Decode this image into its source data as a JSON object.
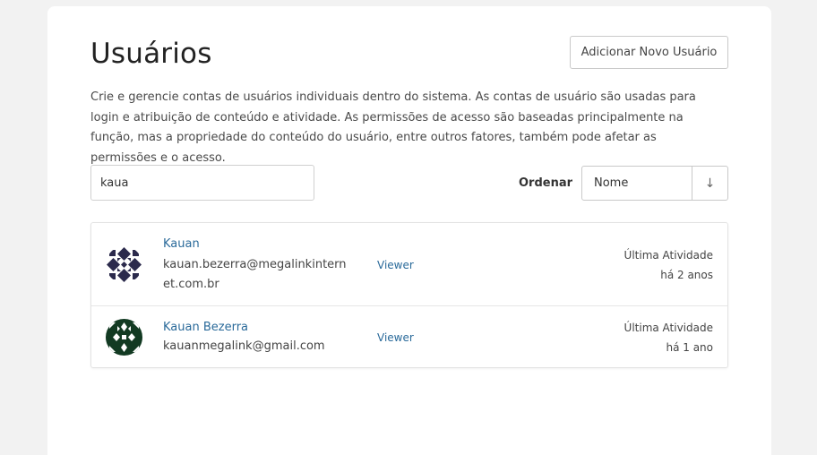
{
  "page": {
    "title": "Usuários",
    "add_button_label": "Adicionar Novo Usuário",
    "description": "Crie e gerencie contas de usuários individuais dentro do sistema. As contas de usuário são usadas para login e atribuição de conteúdo e atividade. As permissões de acesso são baseadas principalmente na função, mas a propriedade do conteúdo do usuário, entre outros fatores, também pode afetar as permissões e o acesso."
  },
  "search": {
    "value": "kaua"
  },
  "sort": {
    "label": "Ordenar",
    "selected": "Nome",
    "direction_icon": "↓"
  },
  "users": [
    {
      "name": "Kauan",
      "email": "kauan.bezerra@megalinkinternet.com.br",
      "role": "Viewer",
      "activity_label": "Última Atividade",
      "activity_value": "há 2 anos",
      "avatar_icon": "identicon-avatar",
      "avatar_color": "#2b2a4c"
    },
    {
      "name": "Kauan Bezerra",
      "email": "kauanmegalink@gmail.com",
      "role": "Viewer",
      "activity_label": "Última Atividade",
      "activity_value": "há 1 ano",
      "avatar_icon": "identicon-avatar",
      "avatar_color": "#123a22"
    }
  ],
  "colors": {
    "link": "#2a6a9a",
    "background": "#f2f2f2",
    "card": "#ffffff"
  }
}
